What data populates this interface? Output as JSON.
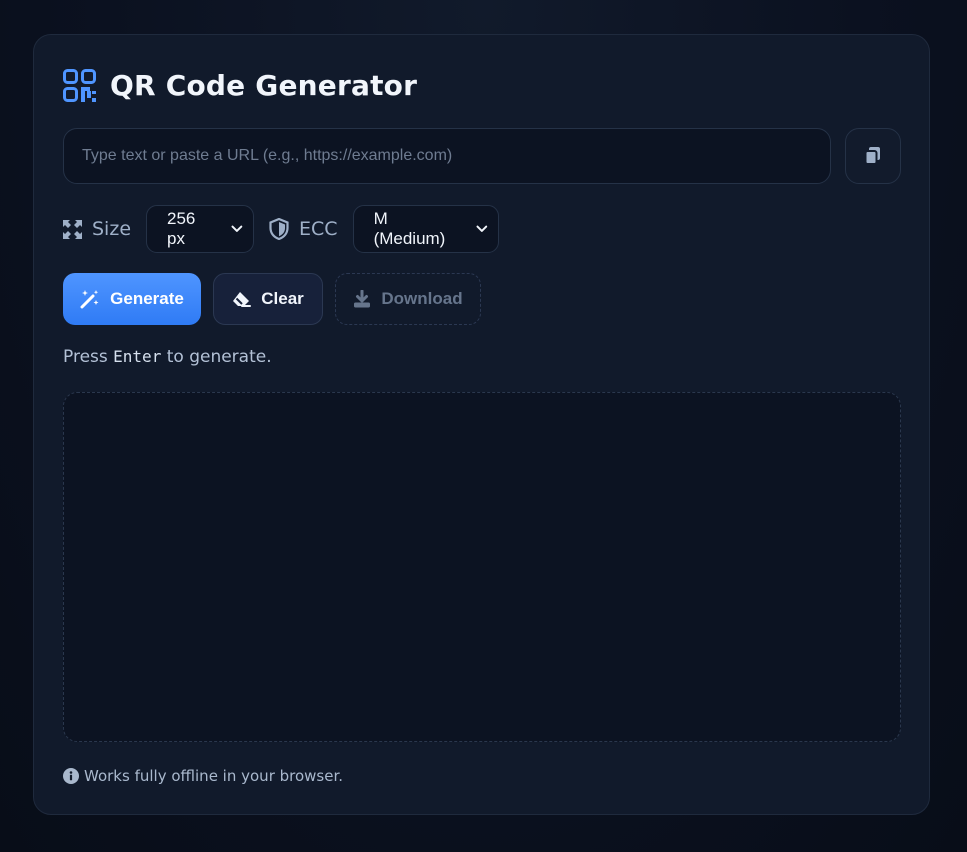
{
  "app": {
    "title": "QR Code Generator",
    "accent_color": "#4f95ff"
  },
  "input": {
    "value": "",
    "placeholder": "Type text or paste a URL (e.g., https://example.com)",
    "paste_icon": "clipboard-icon"
  },
  "options": {
    "size_label": "Size",
    "size_icon": "expand-icon",
    "size_value": "256 px",
    "ecc_label": "ECC",
    "ecc_icon": "shield-icon",
    "ecc_value": "M (Medium)"
  },
  "actions": {
    "generate_label": "Generate",
    "generate_icon": "magic-wand-icon",
    "clear_label": "Clear",
    "clear_icon": "eraser-icon",
    "download_label": "Download",
    "download_icon": "download-icon"
  },
  "hint": {
    "prefix": "Press ",
    "key": "Enter",
    "suffix": " to generate."
  },
  "footer": {
    "icon": "info-icon",
    "text": "Works fully offline in your browser."
  }
}
